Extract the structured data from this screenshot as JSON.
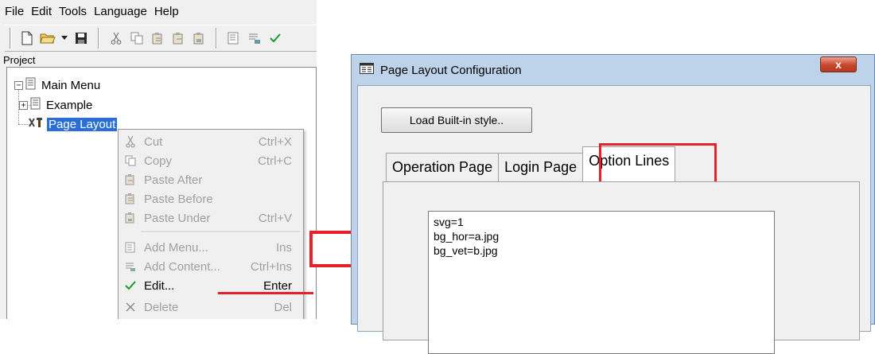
{
  "menubar": {
    "items": [
      "File",
      "Edit",
      "Tools",
      "Language",
      "Help"
    ]
  },
  "project": {
    "label": "Project",
    "tree": [
      {
        "label": "Main Menu",
        "expander": "−"
      },
      {
        "label": "Example",
        "expander": "+"
      },
      {
        "label": "Page Layout"
      }
    ]
  },
  "context_menu": {
    "items": [
      {
        "label": "Cut",
        "shortcut": "Ctrl+X",
        "icon": "scissors-icon"
      },
      {
        "label": "Copy",
        "shortcut": "Ctrl+C",
        "icon": "copy-icon"
      },
      {
        "label": "Paste After",
        "shortcut": "",
        "icon": "paste-after-icon"
      },
      {
        "label": "Paste Before",
        "shortcut": "",
        "icon": "paste-before-icon"
      },
      {
        "label": "Paste Under",
        "shortcut": "Ctrl+V",
        "icon": "paste-under-icon"
      },
      {
        "label": "Add Menu...",
        "shortcut": "Ins",
        "icon": "add-menu-icon"
      },
      {
        "label": "Add Content...",
        "shortcut": "Ctrl+Ins",
        "icon": "add-content-icon"
      },
      {
        "label": "Edit...",
        "shortcut": "Enter",
        "icon": "checkmark-icon"
      },
      {
        "label": "Delete",
        "shortcut": "Del",
        "icon": "delete-x-icon"
      }
    ]
  },
  "dialog": {
    "title": "Page Layout Configuration",
    "close_label": "x",
    "load_button": "Load Built-in style..",
    "tabs": [
      "Operation Page",
      "Login Page",
      "Option Lines"
    ],
    "active_tab": "Option Lines",
    "option_lines": [
      "svg=1",
      "bg_hor=a.jpg",
      "bg_vet=b.jpg"
    ]
  },
  "colors": {
    "annotation_red": "#e8202a",
    "selection_blue": "#2b6fd6",
    "dialog_frame": "#bcd3ea",
    "close_button": "#c8452c"
  }
}
